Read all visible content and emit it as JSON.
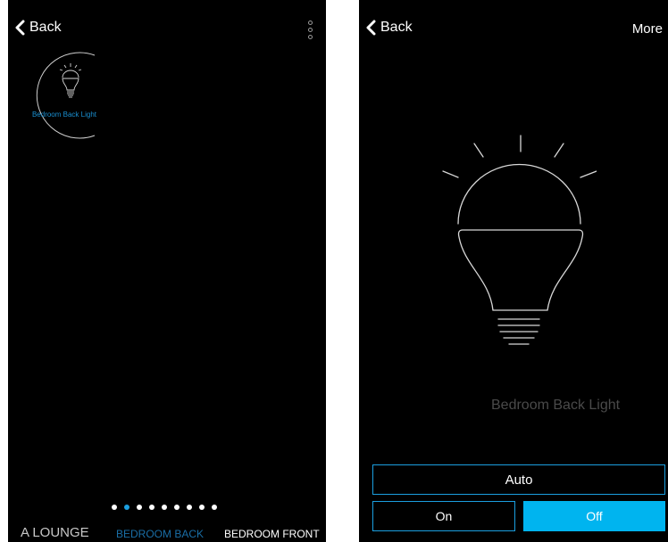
{
  "left": {
    "back_label": "Back",
    "device_tile": {
      "name": "Bedroom Back Light"
    },
    "pager": {
      "count": 9,
      "active_index": 1
    },
    "room_tabs": [
      "A LOUNGE",
      "BEDROOM BACK",
      "BEDROOM FRONT"
    ],
    "active_room_index": 1
  },
  "right": {
    "back_label": "Back",
    "more_label": "More",
    "device_name": "Bedroom Back Light",
    "buttons": {
      "auto": "Auto",
      "on": "On",
      "off": "Off"
    },
    "selected_state": "Off"
  },
  "colors": {
    "background": "#000000",
    "accent": "#1b9fe0",
    "active_fill": "#00b4ef",
    "tile_label": "#1a8fd0"
  },
  "icons": [
    "chevron-left-icon",
    "more-vertical-icon",
    "lightbulb-icon"
  ]
}
